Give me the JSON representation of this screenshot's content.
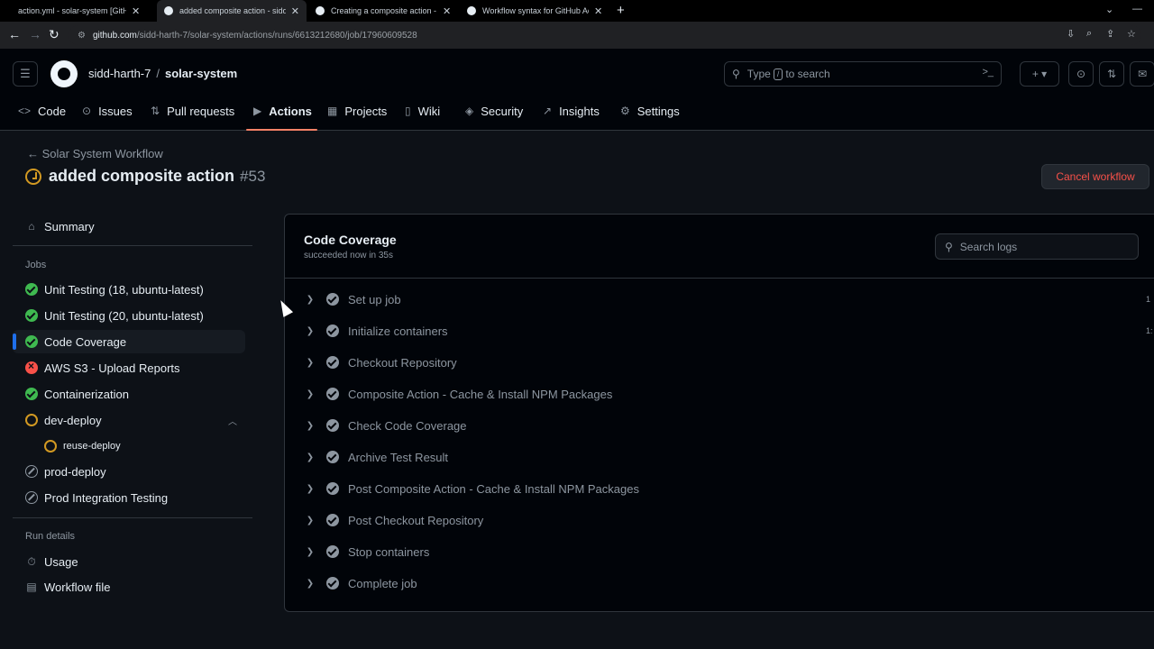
{
  "browser": {
    "tabs": [
      {
        "title": "action.yml - solar-system [GitHu",
        "active": false
      },
      {
        "title": "added composite action - sidd-h",
        "active": true
      },
      {
        "title": "Creating a composite action - G",
        "active": false
      },
      {
        "title": "Workflow syntax for GitHub Acti",
        "active": false
      }
    ],
    "url_host": "github.com",
    "url_path": "/sidd-harth-7/solar-system/actions/runs/6613212680/job/17960609528"
  },
  "header": {
    "owner": "sidd-harth-7",
    "separator": "/",
    "repo": "solar-system",
    "search_prefix": "Type",
    "search_key": "/",
    "search_suffix": "to search"
  },
  "repo_nav": [
    {
      "label": "Code",
      "icon": "code-icon",
      "glyph": "<>"
    },
    {
      "label": "Issues",
      "icon": "issue-icon",
      "glyph": "⊙"
    },
    {
      "label": "Pull requests",
      "icon": "pull-request-icon",
      "glyph": "⇅"
    },
    {
      "label": "Actions",
      "icon": "play-icon",
      "glyph": "▶"
    },
    {
      "label": "Projects",
      "icon": "table-icon",
      "glyph": "▦"
    },
    {
      "label": "Wiki",
      "icon": "book-icon",
      "glyph": "▯"
    },
    {
      "label": "Security",
      "icon": "shield-icon",
      "glyph": "◈"
    },
    {
      "label": "Insights",
      "icon": "graph-icon",
      "glyph": "↗"
    },
    {
      "label": "Settings",
      "icon": "gear-icon",
      "glyph": "⚙"
    }
  ],
  "run": {
    "back_label": "Solar System Workflow",
    "title": "added composite action",
    "number": "#53",
    "cancel_label": "Cancel workflow"
  },
  "sidebar": {
    "summary_label": "Summary",
    "jobs_heading": "Jobs",
    "jobs": [
      {
        "label": "Unit Testing (18, ubuntu-latest)",
        "status": "success"
      },
      {
        "label": "Unit Testing (20, ubuntu-latest)",
        "status": "success"
      },
      {
        "label": "Code Coverage",
        "status": "success"
      },
      {
        "label": "AWS S3 - Upload Reports",
        "status": "failure"
      },
      {
        "label": "Containerization",
        "status": "success"
      },
      {
        "label": "dev-deploy",
        "status": "in-progress"
      },
      {
        "label": "reuse-deploy",
        "status": "in-progress"
      },
      {
        "label": "prod-deploy",
        "status": "skipped"
      },
      {
        "label": "Prod Integration Testing",
        "status": "skipped"
      }
    ],
    "run_details_heading": "Run details",
    "usage_label": "Usage",
    "workflow_file_label": "Workflow file"
  },
  "log": {
    "job_title": "Code Coverage",
    "job_subtitle": "succeeded now in 35s",
    "search_placeholder": "Search logs",
    "steps": [
      {
        "label": "Set up job",
        "duration": "1"
      },
      {
        "label": "Initialize containers",
        "duration": "1:"
      },
      {
        "label": "Checkout Repository",
        "duration": ""
      },
      {
        "label": "Composite Action - Cache & Install NPM Packages",
        "duration": ""
      },
      {
        "label": "Check Code Coverage",
        "duration": ""
      },
      {
        "label": "Archive Test Result",
        "duration": ""
      },
      {
        "label": "Post Composite Action - Cache & Install NPM Packages",
        "duration": ""
      },
      {
        "label": "Post Checkout Repository",
        "duration": ""
      },
      {
        "label": "Stop containers",
        "duration": ""
      },
      {
        "label": "Complete job",
        "duration": ""
      }
    ]
  },
  "colors": {
    "background": "#0d1117",
    "success": "#3fb950",
    "failure": "#f85149",
    "pending": "#d29922",
    "selected_underline": "#f78166",
    "selected_marker": "#1f6feb"
  }
}
